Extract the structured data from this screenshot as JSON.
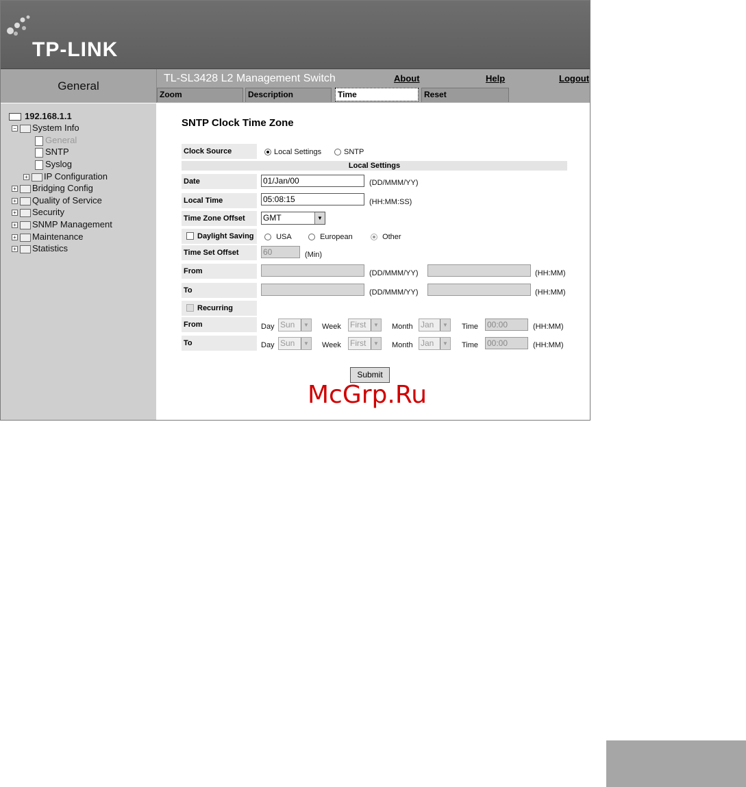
{
  "banner": {
    "logo_text": "TP-LINK"
  },
  "header": {
    "section": "General",
    "product": "TL-SL3428 L2 Management Switch",
    "links": {
      "about": "About",
      "help": "Help",
      "logout": "Logout"
    },
    "tabs": [
      "Zoom",
      "Description",
      "Time",
      "Reset"
    ],
    "active_tab": "Time"
  },
  "sidebar": {
    "root": "192.168.1.1",
    "items": [
      "System Info",
      "General",
      "SNTP",
      "Syslog",
      "IP Configuration",
      "Bridging Config",
      "Quality of Service",
      "Security",
      "SNMP Management",
      "Maintenance",
      "Statistics"
    ]
  },
  "form": {
    "title": "SNTP Clock Time Zone",
    "clock_source_label": "Clock Source",
    "clock_source_options": [
      "Local Settings",
      "SNTP"
    ],
    "clock_source_selected": "Local Settings",
    "local_settings_header": "Local Settings",
    "date_label": "Date",
    "date_value": "01/Jan/00",
    "date_hint": "(DD/MMM/YY)",
    "local_time_label": "Local Time",
    "local_time_value": "05:08:15",
    "local_time_hint": "(HH:MM:SS)",
    "tz_label": "Time Zone Offset",
    "tz_value": "GMT",
    "daylight_label": "Daylight Saving",
    "daylight_options": [
      "USA",
      "European",
      "Other"
    ],
    "daylight_selected": "Other",
    "offset_label": "Time Set Offset",
    "offset_value": "60",
    "offset_unit": "(Min)",
    "from_label": "From",
    "to_label": "To",
    "date_fmt": "(DD/MMM/YY)",
    "time_fmt": "(HH:MM)",
    "recurring_label": "Recurring",
    "rec_day_label": "Day",
    "rec_day_value": "Sun",
    "rec_week_label": "Week",
    "rec_week_value": "First",
    "rec_month_label": "Month",
    "rec_month_value": "Jan",
    "rec_time_label": "Time",
    "rec_time_value": "00:00",
    "submit": "Submit"
  },
  "watermark": "McGrp.Ru"
}
